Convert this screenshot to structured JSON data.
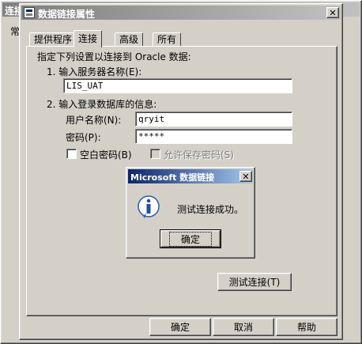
{
  "background_window": {
    "title": "连接",
    "tab_hint": "常"
  },
  "main_dialog": {
    "title": "数据链接属性",
    "close_glyph": "✕",
    "tabs": [
      {
        "label": "提供程序",
        "selected": false
      },
      {
        "label": "连接",
        "selected": true
      },
      {
        "label": "高级",
        "selected": false
      },
      {
        "label": "所有",
        "selected": false
      }
    ],
    "instruction": "指定下列设置以连接到 Oracle 数据:",
    "step1_label": "1. 输入服务器名称(E):",
    "server_name_value": "LIS_UAT",
    "step2_label": "2. 输入登录数据库的信息:",
    "username_label": "用户名称(N):",
    "username_value": "qryit",
    "password_label": "密码(P):",
    "password_value": "*****",
    "blank_password_label": "空白密码(B)",
    "allow_save_password_label": "允许保存密码(S)",
    "test_connection_button": "测试连接(T)",
    "ok_button": "确定",
    "cancel_button": "取消",
    "help_button": "帮助"
  },
  "message_box": {
    "title": "Microsoft 数据链接",
    "close_glyph": "✕",
    "message": "测试连接成功。",
    "ok_button": "确定",
    "icon": "info-icon"
  },
  "colors": {
    "dialog_face": "#d4d0c8",
    "active_title_start": "#0a246a",
    "active_title_end": "#a6caf0",
    "inactive_title_start": "#808080",
    "inactive_title_end": "#c0c0c0"
  }
}
